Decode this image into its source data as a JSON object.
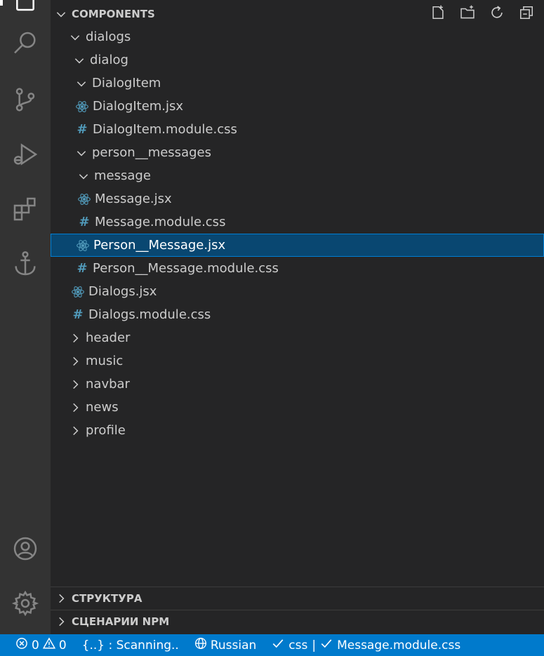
{
  "explorer": {
    "section_title": "COMPONENTS",
    "tree": [
      {
        "label": "dialogs",
        "kind": "folder",
        "expanded": true,
        "indent": 24
      },
      {
        "label": "dialog",
        "kind": "folder",
        "expanded": true,
        "indent": 30
      },
      {
        "label": "DialogItem",
        "kind": "folder",
        "expanded": true,
        "indent": 33
      },
      {
        "label": "DialogItem.jsx",
        "kind": "jsx",
        "indent": 34
      },
      {
        "label": "DialogItem.module.css",
        "kind": "css",
        "indent": 34
      },
      {
        "label": "person__messages",
        "kind": "folder",
        "expanded": true,
        "indent": 33
      },
      {
        "label": "message",
        "kind": "folder",
        "expanded": true,
        "indent": 36
      },
      {
        "label": "Message.jsx",
        "kind": "jsx",
        "indent": 37
      },
      {
        "label": "Message.module.css",
        "kind": "css",
        "indent": 37
      },
      {
        "label": "Person__Message.jsx",
        "kind": "jsx",
        "indent": 34,
        "selected": true
      },
      {
        "label": "Person__Message.module.css",
        "kind": "css",
        "indent": 34
      },
      {
        "label": "Dialogs.jsx",
        "kind": "jsx",
        "indent": 28
      },
      {
        "label": "Dialogs.module.css",
        "kind": "css",
        "indent": 28
      },
      {
        "label": "header",
        "kind": "folder",
        "expanded": false,
        "indent": 24
      },
      {
        "label": "music",
        "kind": "folder",
        "expanded": false,
        "indent": 24
      },
      {
        "label": "navbar",
        "kind": "folder",
        "expanded": false,
        "indent": 24
      },
      {
        "label": "news",
        "kind": "folder",
        "expanded": false,
        "indent": 24
      },
      {
        "label": "profile",
        "kind": "folder",
        "expanded": false,
        "indent": 24
      }
    ],
    "bottom_sections": [
      {
        "label": "СТРУКТУРА"
      },
      {
        "label": "СЦЕНАРИИ NPM"
      }
    ]
  },
  "header_actions": [
    "new-file-icon",
    "new-folder-icon",
    "refresh-icon",
    "collapse-all-icon"
  ],
  "status_bar": {
    "errors": "0",
    "warnings": "0",
    "scanning": "{..} : Scanning..",
    "language": "Russian",
    "css": "css",
    "separator": "|",
    "file": "Message.module.css"
  },
  "colors": {
    "activity_bar": "#333333",
    "sidebar": "#252526",
    "selection": "#094771",
    "status_bar": "#007acc",
    "react_icon": "#519aba"
  }
}
